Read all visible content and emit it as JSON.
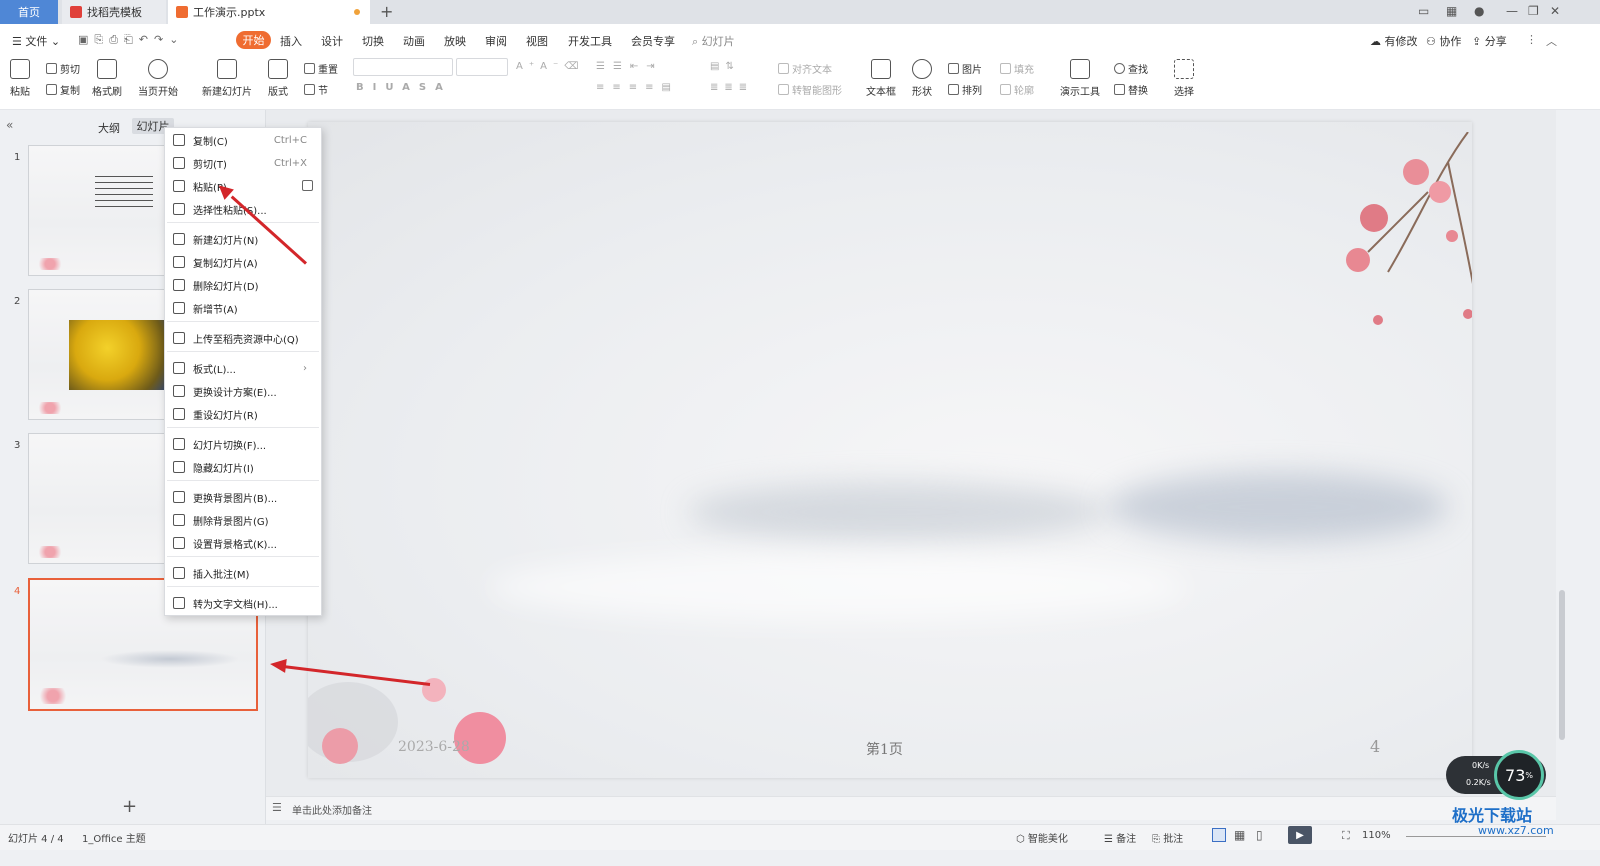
{
  "tabs": {
    "home": "首页",
    "templates": "找稻壳模板",
    "document": "工作演示.pptx",
    "new_tab": "+"
  },
  "menu": {
    "file": "文件",
    "items": [
      "开始",
      "插入",
      "设计",
      "切换",
      "动画",
      "放映",
      "审阅",
      "视图",
      "开发工具",
      "会员专享"
    ],
    "search": "幻灯片",
    "right": [
      "有修改",
      "协作",
      "分享"
    ]
  },
  "ribbon": {
    "paste": "粘贴",
    "cut": "剪切",
    "copy": "复制",
    "format_painter": "格式刷",
    "from_current": "当页开始",
    "new_slide": "新建幻灯片",
    "layout": "版式",
    "section": "节",
    "reset": "重置",
    "align_text": "对齐文本",
    "smart_shape": "转智能图形",
    "textbox": "文本框",
    "shape": "形状",
    "picture": "图片",
    "arrange": "排列",
    "fill": "填充",
    "outline": "轮廓",
    "presenter_tools": "演示工具",
    "find": "查找",
    "replace": "替换",
    "select": "选择"
  },
  "left_panel": {
    "outline_tab": "大纲",
    "slides_tab": "幻灯片",
    "slide_numbers": [
      "1",
      "2",
      "3",
      "4"
    ],
    "add": "+"
  },
  "context_menu": [
    {
      "label": "复制(C)",
      "shortcut": "Ctrl+C"
    },
    {
      "label": "剪切(T)",
      "shortcut": "Ctrl+X"
    },
    {
      "label": "粘贴(P)",
      "shortcut": ""
    },
    {
      "label": "选择性粘贴(S)...",
      "shortcut": ""
    },
    {
      "label": "新建幻灯片(N)",
      "shortcut": ""
    },
    {
      "label": "复制幻灯片(A)",
      "shortcut": ""
    },
    {
      "label": "删除幻灯片(D)",
      "shortcut": ""
    },
    {
      "label": "新增节(A)",
      "shortcut": ""
    },
    {
      "label": "上传至稻壳资源中心(Q)",
      "shortcut": ""
    },
    {
      "label": "板式(L)...",
      "shortcut": "›"
    },
    {
      "label": "更换设计方案(E)...",
      "shortcut": ""
    },
    {
      "label": "重设幻灯片(R)",
      "shortcut": ""
    },
    {
      "label": "幻灯片切换(F)...",
      "shortcut": ""
    },
    {
      "label": "隐藏幻灯片(I)",
      "shortcut": ""
    },
    {
      "label": "更换背景图片(B)...",
      "shortcut": ""
    },
    {
      "label": "删除背景图片(G)",
      "shortcut": ""
    },
    {
      "label": "设置背景格式(K)...",
      "shortcut": ""
    },
    {
      "label": "插入批注(M)",
      "shortcut": ""
    },
    {
      "label": "转为文字文档(H)...",
      "shortcut": ""
    }
  ],
  "slide": {
    "date": "2023-6-28",
    "footer": "第1页",
    "number": "4"
  },
  "notes_placeholder": "单击此处添加备注",
  "status": {
    "slide_count": "幻灯片 4 / 4",
    "theme": "1_Office 主题",
    "beautify": "智能美化",
    "notes": "备注",
    "comments": "批注",
    "zoom": "110%",
    "net_up": "0K/s",
    "net_down": "0.2K/s",
    "cpu": "73",
    "watermark": "极光下载站",
    "watermark_url": "www.xz7.com"
  },
  "colors": {
    "accent": "#ef6c31",
    "home_tab": "#4f87d6",
    "selection": "#e8603a",
    "arrow": "#d3262a"
  }
}
